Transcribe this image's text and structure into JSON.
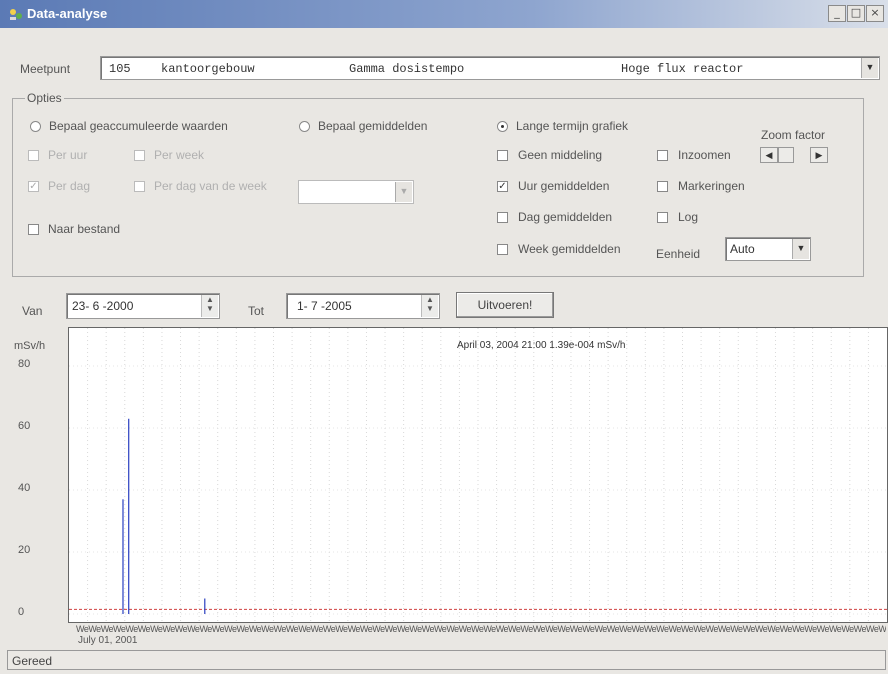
{
  "window": {
    "title": "Data-analyse",
    "buttons": [
      "_",
      "□",
      "×"
    ]
  },
  "meetpunt": {
    "label": "Meetpunt",
    "code": "105",
    "location": "kantoorgebouw",
    "quantity": "Gamma dosistempo",
    "site": "Hoge flux reactor"
  },
  "options": {
    "legend": "Opties",
    "mode_radios": [
      {
        "label": "Bepaal geaccumuleerde waarden",
        "selected": false
      },
      {
        "label": "Bepaal gemiddelden",
        "selected": false
      },
      {
        "label": "Lange termijn grafiek",
        "selected": true
      }
    ],
    "per_uur": {
      "label": "Per uur",
      "checked": false,
      "enabled": false
    },
    "per_week": {
      "label": "Per week",
      "checked": false,
      "enabled": false
    },
    "per_dag": {
      "label": "Per dag",
      "checked": true,
      "enabled": false
    },
    "per_dag_week": {
      "label": "Per dag van de week",
      "checked": false,
      "enabled": false
    },
    "naar_bestand": {
      "label": "Naar bestand",
      "checked": false
    },
    "geen_middeling": {
      "label": "Geen middeling",
      "checked": false
    },
    "uur_gemiddelden": {
      "label": "Uur gemiddelden",
      "checked": true
    },
    "dag_gemiddelden": {
      "label": "Dag gemiddelden",
      "checked": false
    },
    "week_gemiddelden": {
      "label": "Week gemiddelden",
      "checked": false
    },
    "inzoomen": {
      "label": "Inzoomen",
      "checked": false
    },
    "markeringen": {
      "label": "Markeringen",
      "checked": false
    },
    "log": {
      "label": "Log",
      "checked": false
    },
    "zoom_label": "Zoom factor",
    "eenheid_label": "Eenheid",
    "eenheid_value": "Auto"
  },
  "dates": {
    "van_label": "Van",
    "van_value": "23- 6 -2000",
    "tot_label": "Tot",
    "tot_value": "1- 7 -2005",
    "run_label": "Uitvoeren!"
  },
  "chart_data": {
    "type": "line",
    "ylabel": "mSv/h",
    "yticks": [
      80,
      60,
      40,
      20,
      0
    ],
    "ylim": [
      0,
      85
    ],
    "annotation": "April 03, 2004 21:00 1.39e-004 mSv/h",
    "x_tick_label": "We",
    "x_tick_count": 84,
    "x_date_label": "July 01, 2001",
    "grid": true,
    "series": [
      {
        "spikes": [
          {
            "pos": 0.066,
            "value": 37
          },
          {
            "pos": 0.073,
            "value": 63
          },
          {
            "pos": 0.166,
            "value": 5
          }
        ],
        "color": "#2a3fc0"
      }
    ],
    "baseline": {
      "value": 1.5,
      "color": "#d04040"
    }
  },
  "status": {
    "text": "Gereed"
  }
}
